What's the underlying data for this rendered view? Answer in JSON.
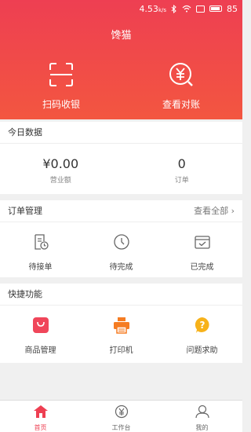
{
  "status_bar": {
    "speed": "4.53",
    "speed_unit": "k/s",
    "battery": "85"
  },
  "app": {
    "title": "馋猫"
  },
  "header_actions": [
    {
      "label": "扫码收银",
      "icon": "scan-icon"
    },
    {
      "label": "查看对账",
      "icon": "yen-check-icon"
    }
  ],
  "today": {
    "title": "今日数据",
    "stats": [
      {
        "value": "¥0.00",
        "caption": "营业额"
      },
      {
        "value": "0",
        "caption": "订单"
      }
    ]
  },
  "orders": {
    "title": "订单管理",
    "more": "查看全部",
    "items": [
      {
        "label": "待接单",
        "icon": "document-clock-icon"
      },
      {
        "label": "待完成",
        "icon": "clock-icon"
      },
      {
        "label": "已完成",
        "icon": "check-tray-icon"
      }
    ]
  },
  "quick": {
    "title": "快捷功能",
    "items": [
      {
        "label": "商品管理",
        "icon": "shopping-bag-icon",
        "color": "#f0465a"
      },
      {
        "label": "打印机",
        "icon": "printer-icon",
        "color": "#f57c22"
      },
      {
        "label": "问题求助",
        "icon": "help-icon",
        "color": "#f7b21a"
      }
    ]
  },
  "tabbar": [
    {
      "label": "首页",
      "icon": "home-icon",
      "active": true
    },
    {
      "label": "工作台",
      "icon": "workbench-yen-icon",
      "active": false
    },
    {
      "label": "我的",
      "icon": "profile-icon",
      "active": false
    }
  ],
  "colors": {
    "accent": "#ee3f52",
    "header_bottom": "#f35640"
  }
}
